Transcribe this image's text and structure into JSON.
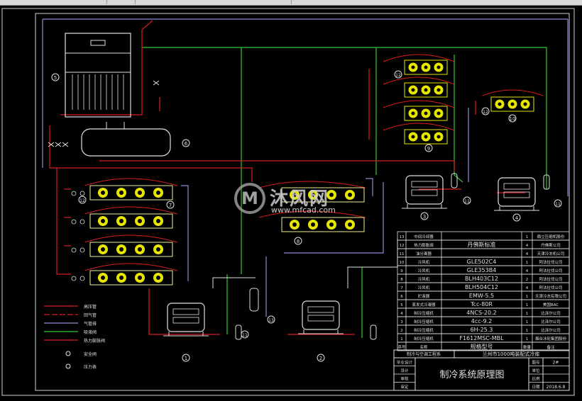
{
  "drawing_title": "制冷系统原理图",
  "project_title": "兰州市1000吨装配式冷库",
  "company": "制冷与空调工程系",
  "legend": [
    {
      "label": "高压管",
      "color": "#d81e1e"
    },
    {
      "label": "回气管",
      "color": "#d81e1e"
    },
    {
      "label": "气管排",
      "color": "#8c8cd8"
    },
    {
      "label": "吸液阀",
      "color": "#32c832"
    },
    {
      "label": "热力膨胀阀",
      "color": "#d81e1e"
    },
    {
      "label": "安全阀",
      "color": "#c8c8c8"
    },
    {
      "label": "压力表",
      "color": "#c8c8c8"
    }
  ],
  "bom_header": {
    "no": "序号",
    "name": "名称",
    "model": "规格型号",
    "qty": "数量",
    "note": "备注"
  },
  "bom_rows": [
    {
      "no": "13",
      "name": "中间冷却器",
      "model": "",
      "qty": "1",
      "note": "鼎立压缩机股份"
    },
    {
      "no": "12",
      "name": "热力膨胀阀",
      "model": "丹佛斯标准",
      "qty": "4",
      "note": "丹佛斯公司"
    },
    {
      "no": "11",
      "name": "油分离器",
      "model": "",
      "qty": "4",
      "note": "天津冷冻机公司"
    },
    {
      "no": "10",
      "name": "冷风机",
      "model": "GLE502C4",
      "qty": "1",
      "note": "阿法拉伐公司"
    },
    {
      "no": "9",
      "name": "冷风机",
      "model": "GLE353B4",
      "qty": "4",
      "note": "阿法拉伐公司"
    },
    {
      "no": "8",
      "name": "冷风机",
      "model": "BLH403C12",
      "qty": "2",
      "note": "阿法拉伐公司"
    },
    {
      "no": "7",
      "name": "冷风机",
      "model": "BLH504C12",
      "qty": "4",
      "note": "阿法拉伐公司"
    },
    {
      "no": "6",
      "name": "贮液器",
      "model": "EMW-5.5",
      "qty": "1",
      "note": "天津冷冻有限公司"
    },
    {
      "no": "5",
      "name": "蒸发式冷凝器",
      "model": "Tcc-80R",
      "qty": "1",
      "note": "美国BAC"
    },
    {
      "no": "4",
      "name": "制冷压缩机",
      "model": "4NCS-20.2",
      "qty": "1",
      "note": "比泽尔公司"
    },
    {
      "no": "3",
      "name": "制冷压缩机",
      "model": "4cc-9.2",
      "qty": "1",
      "note": "比泽尔公司"
    },
    {
      "no": "2",
      "name": "制冷压缩机",
      "model": "6H-25.3",
      "qty": "1",
      "note": "比泽尔公司"
    },
    {
      "no": "1",
      "name": "制冷压缩机",
      "model": "F1612MSC-MBL",
      "qty": "1",
      "note": "烟台冰轮集团股份"
    }
  ],
  "signoff": [
    {
      "label": "毕业设计",
      "k2": "图号",
      "v2": "2#"
    },
    {
      "label": "设计",
      "k2": "单位",
      "v2": ""
    },
    {
      "label": "审核",
      "k2": "比例",
      "v2": ""
    },
    {
      "label": "审定",
      "k2": "日期",
      "v2": "2018.6.8"
    }
  ],
  "equipment_markers": {
    "condenser": "5",
    "receiver": "6",
    "coolers_7": "7",
    "coolers_8": "8",
    "coolers_9": "9",
    "cooler_10": "10",
    "comp_1": "1",
    "comp_2": "2",
    "comp_3": "3",
    "comp_4": "4",
    "oil_sep": "11",
    "valve": "12",
    "intercooler": "13"
  },
  "watermark": {
    "logo": "M",
    "title": "沐风网",
    "url": "www.mfcad.com"
  }
}
